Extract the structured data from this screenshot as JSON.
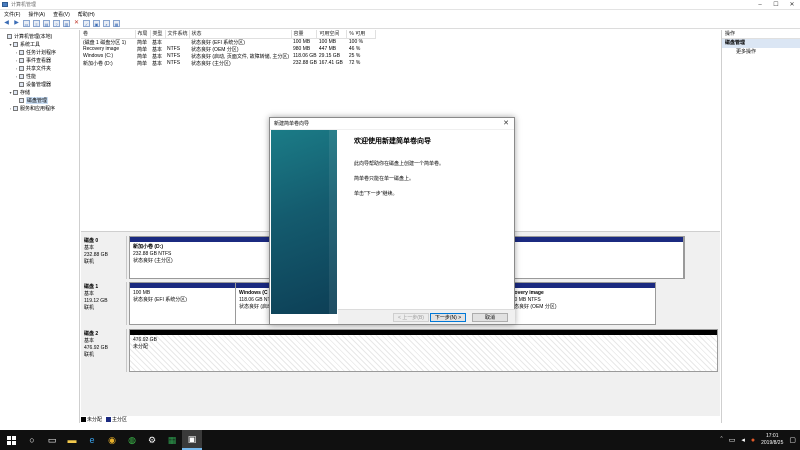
{
  "window": {
    "title": "计算机管理"
  },
  "menu": [
    "文件(F)",
    "操作(A)",
    "查看(V)",
    "帮助(H)"
  ],
  "tree": [
    {
      "label": "计算机管理(本地)",
      "indent": 0,
      "exp": ""
    },
    {
      "label": "系统工具",
      "indent": 1,
      "exp": "▾"
    },
    {
      "label": "任务计划程序",
      "indent": 2,
      "exp": "›"
    },
    {
      "label": "事件查看器",
      "indent": 2,
      "exp": "›"
    },
    {
      "label": "共享文件夹",
      "indent": 2,
      "exp": "›"
    },
    {
      "label": "性能",
      "indent": 2,
      "exp": "›"
    },
    {
      "label": "设备管理器",
      "indent": 2,
      "exp": ""
    },
    {
      "label": "存储",
      "indent": 1,
      "exp": "▾"
    },
    {
      "label": "磁盘管理",
      "indent": 2,
      "exp": "",
      "selected": true
    },
    {
      "label": "服务和应用程序",
      "indent": 1,
      "exp": "›"
    }
  ],
  "volumes": {
    "columns": [
      "卷",
      "布局",
      "类型",
      "文件系统",
      "状态",
      "容量",
      "可用空间",
      "% 可用"
    ],
    "rows": [
      [
        "(磁盘 1 磁盘分区 1)",
        "简单",
        "基本",
        "",
        "状态良好 (EFI 系统分区)",
        "100 MB",
        "100 MB",
        "100 %"
      ],
      [
        "Recovery image",
        "简单",
        "基本",
        "NTFS",
        "状态良好 (OEM 分区)",
        "980 MB",
        "447 MB",
        "46 %"
      ],
      [
        "Windows (C:)",
        "简单",
        "基本",
        "NTFS",
        "状态良好 (启动, 页面文件, 故障转储, 主分区)",
        "118.06 GB",
        "29.15 GB",
        "25 %"
      ],
      [
        "新加小卷 (D:)",
        "简单",
        "基本",
        "NTFS",
        "状态良好 (主分区)",
        "232.88 GB",
        "167.41 GB",
        "72 %"
      ]
    ]
  },
  "disks": [
    {
      "name": "磁盘 0",
      "type": "基本",
      "size": "232.88 GB",
      "status": "联机",
      "partitions": [
        {
          "name": "新加小卷 (D:)",
          "size": "232.88 GB NTFS",
          "status": "状态良好 (主分区)"
        }
      ]
    },
    {
      "name": "磁盘 1",
      "type": "基本",
      "size": "119.12 GB",
      "status": "联机",
      "partitions": [
        {
          "name": "",
          "size": "100 MB",
          "status": "状态良好 (EFI 系统分区)"
        },
        {
          "name": "Windows (C",
          "size": "118.06 GB NTFS",
          "status": "状态良好 (启动"
        },
        {
          "name": "ecovery image",
          "size": "980 MB NTFS",
          "status": "状态良好 (OEM 分区)"
        }
      ]
    },
    {
      "name": "磁盘 2",
      "type": "基本",
      "size": "476.92 GB",
      "status": "联机",
      "partitions": [
        {
          "name": "",
          "size": "476.92 GB",
          "status": "未分配"
        }
      ]
    }
  ],
  "legend": {
    "unallocated": "未分配",
    "primary": "主分区"
  },
  "actions": {
    "header": "操作",
    "section": "磁盘管理",
    "more": "更多操作"
  },
  "wizard": {
    "title": "新建简单卷向导",
    "heading": "欢迎使用新建简单卷向导",
    "para1": "此向导帮助你在磁盘上创建一个简单卷。",
    "para2": "简单卷只能在单一磁盘上。",
    "para3": "单击\"下一步\"继续。",
    "back": "< 上一步(B)",
    "next": "下一步(N) >",
    "cancel": "取消"
  },
  "taskbar": {
    "time": "17:01",
    "date": "2019/8/25"
  },
  "colors": {
    "primary_partition": "#1b2a80",
    "unallocated": "#000000",
    "accent": "#0078d7"
  }
}
